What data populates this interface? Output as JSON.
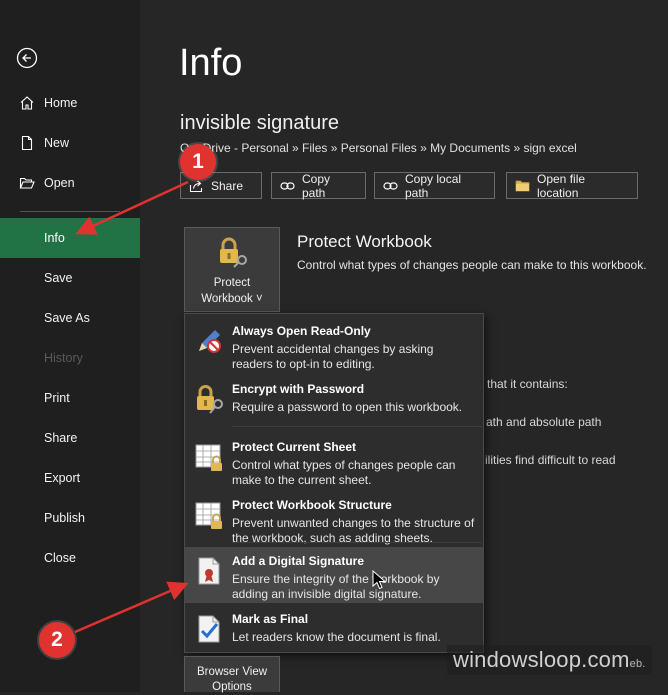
{
  "sidebar": {
    "back_icon": "back-arrow-icon",
    "items": [
      {
        "label": "Home",
        "icon": "home-icon"
      },
      {
        "label": "New",
        "icon": "new-document-icon"
      },
      {
        "label": "Open",
        "icon": "folder-open-icon"
      },
      {
        "label": "Info"
      },
      {
        "label": "Save"
      },
      {
        "label": "Save As"
      },
      {
        "label": "History"
      },
      {
        "label": "Print"
      },
      {
        "label": "Share"
      },
      {
        "label": "Export"
      },
      {
        "label": "Publish"
      },
      {
        "label": "Close"
      }
    ],
    "active_color": "#217346"
  },
  "main": {
    "title": "Info",
    "doc_name": "invisible signature",
    "doc_path": "OneDrive - Personal » Files » Personal Files » My Documents » sign excel",
    "actions": [
      {
        "label": "Share",
        "icon": "share-icon"
      },
      {
        "label": "Copy path",
        "icon": "link-icon"
      },
      {
        "label": "Copy local path",
        "icon": "link-icon"
      },
      {
        "label": "Open file location",
        "icon": "folder-icon"
      }
    ],
    "protect": {
      "tile_line1": "Protect",
      "tile_line2": "Workbook ˅",
      "heading": "Protect Workbook",
      "description": "Control what types of changes people can make to this workbook."
    },
    "background_text": [
      "that it contains:",
      "ath and absolute path",
      "ilities find difficult to read"
    ],
    "browser_view": {
      "line1": "Browser View",
      "line2": "Options"
    }
  },
  "menu": {
    "items": [
      {
        "title": "Always Open Read-Only",
        "desc": "Prevent accidental changes by asking readers to opt-in to editing.",
        "icon": "pencil-no-icon"
      },
      {
        "title": "Encrypt with Password",
        "desc": "Require a password to open this workbook.",
        "icon": "lock-key-icon"
      },
      {
        "title": "Protect Current Sheet",
        "desc": "Control what types of changes people can make to the current sheet.",
        "icon": "sheet-lock-icon"
      },
      {
        "title": "Protect Workbook Structure",
        "desc": "Prevent unwanted changes to the structure of the workbook, such as adding sheets.",
        "icon": "workbook-lock-icon"
      },
      {
        "title": "Add a Digital Signature",
        "desc": "Ensure the integrity of the workbook by adding an invisible digital signature.",
        "icon": "digital-signature-icon"
      },
      {
        "title": "Mark as Final",
        "desc": "Let readers know the document is final.",
        "icon": "mark-final-icon"
      }
    ]
  },
  "annotations": {
    "badge_1": "1",
    "badge_2": "2",
    "color": "#e0332f"
  },
  "watermark": {
    "main": "windowsloop.com",
    "suffix": "eb."
  }
}
